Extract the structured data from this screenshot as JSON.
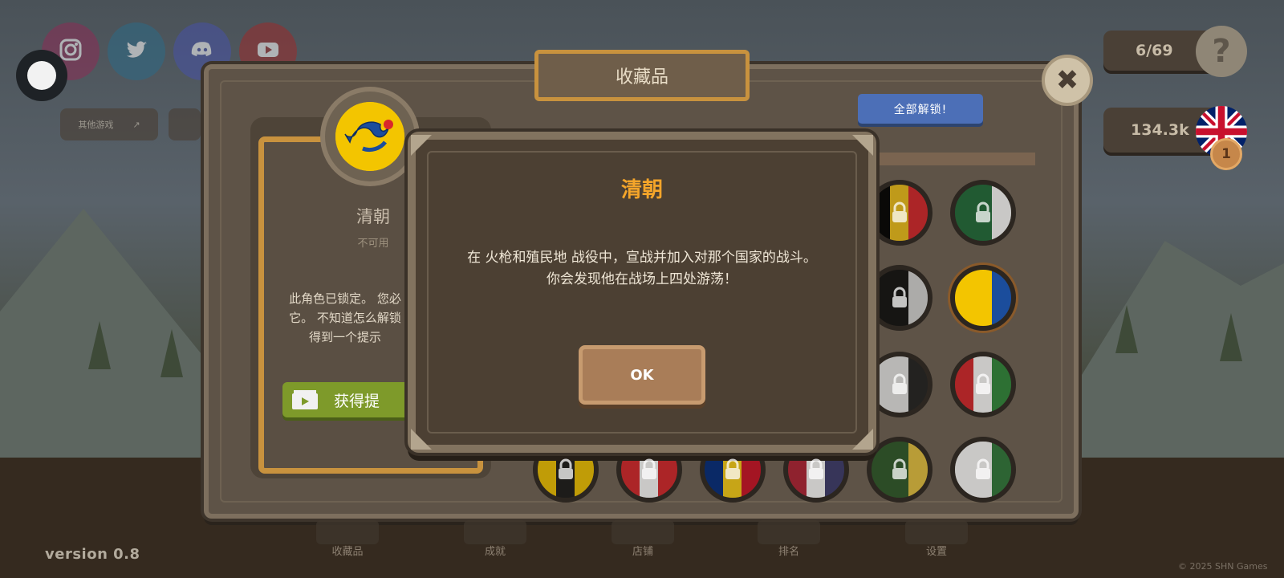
{
  "social": [
    {
      "name": "instagram-icon",
      "color": "#8b2d55"
    },
    {
      "name": "twitter-icon",
      "color": "#2d6a86"
    },
    {
      "name": "discord-icon",
      "color": "#4752a6"
    },
    {
      "name": "youtube-icon",
      "color": "#9b2b2b"
    }
  ],
  "top_left": {
    "other_games": "其他游戏"
  },
  "hud": {
    "collection_count": "6/69",
    "coins": "134.3k",
    "rank_badge": "1"
  },
  "panel": {
    "title": "收藏品",
    "unlock_all": "全部解锁!",
    "close_glyph": "✖"
  },
  "card": {
    "name": "清朝",
    "status": "不可用",
    "description_lines": [
      "此角色已锁定。 您必",
      "它。 不知道怎么解锁",
      "得到一个提示"
    ],
    "hint_button": "获得提"
  },
  "modal": {
    "title": "清朝",
    "body_line1": "在 火枪和殖民地 战役中，宣战并加入对那个国家的战斗。",
    "body_line2": "你会发现他在战场上四处游荡！",
    "ok": "OK"
  },
  "balls": [
    {
      "flag": "belgium",
      "colors": [
        "#000000",
        "#f2c21a",
        "#d9262b"
      ],
      "locked": true
    },
    {
      "flag": "green",
      "colors": [
        "#1f6d3a",
        "#1f6d3a",
        "#ffffff"
      ],
      "locked": true
    },
    {
      "flag": "black",
      "colors": [
        "#111111",
        "#111111",
        "#d9d9d9"
      ],
      "locked": true
    },
    {
      "flag": "qing",
      "colors": [
        "#f3c500",
        "#f3c500",
        "#1b4d9c"
      ],
      "locked": false
    },
    {
      "flag": "white",
      "colors": [
        "#e8e8e8",
        "#e8e8e8",
        "#222222"
      ],
      "locked": true
    },
    {
      "flag": "mixed",
      "colors": [
        "#d9262b",
        "#ffffff",
        "#2f8a3b"
      ],
      "locked": true
    },
    {
      "flag": "yellow",
      "colors": [
        "#f3c500",
        "#1a1a1a",
        "#f3c500"
      ],
      "locked": true
    },
    {
      "flag": "red-white",
      "colors": [
        "#d9262b",
        "#ffffff",
        "#d9262b"
      ],
      "locked": true
    },
    {
      "flag": "romania",
      "colors": [
        "#002b7f",
        "#fcd116",
        "#ce1126"
      ],
      "locked": true
    },
    {
      "flag": "usa",
      "colors": [
        "#b22234",
        "#ffffff",
        "#3c3b6e"
      ],
      "locked": true
    },
    {
      "flag": "dark-green",
      "colors": [
        "#2e5a2a",
        "#2e5a2a",
        "#e8c540"
      ],
      "locked": true
    },
    {
      "flag": "white-green",
      "colors": [
        "#ffffff",
        "#ffffff",
        "#2f7a3b"
      ],
      "locked": true
    }
  ],
  "bottom_nav": [
    "收藏品",
    "成就",
    "店铺",
    "排名",
    "设置"
  ],
  "footer": {
    "version": "version 0.8",
    "copyright": "© 2025 SHN Games"
  }
}
